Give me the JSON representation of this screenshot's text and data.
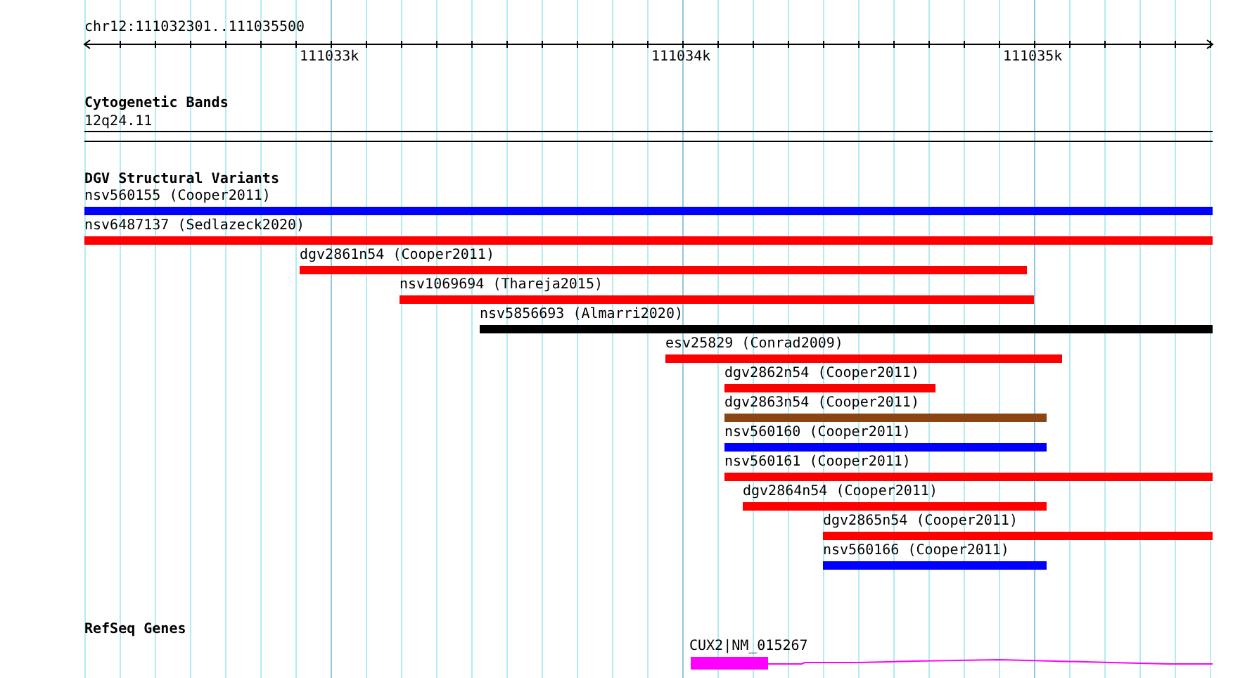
{
  "location": "chr12:111032301..111035500",
  "ruler": {
    "tick_labels": [
      "111033k",
      "111034k",
      "111035k"
    ]
  },
  "cytogenetic_bands": {
    "title": "Cytogenetic Bands",
    "band": "12q24.11"
  },
  "dgv": {
    "title": "DGV Structural Variants",
    "variants": [
      {
        "label": "nsv560155 (Cooper2011)",
        "color": "#0000ff"
      },
      {
        "label": "nsv6487137 (Sedlazeck2020)",
        "color": "#ff0000"
      },
      {
        "label": "dgv2861n54 (Cooper2011)",
        "color": "#ff0000"
      },
      {
        "label": "nsv1069694 (Thareja2015)",
        "color": "#ff0000"
      },
      {
        "label": "nsv5856693 (Almarri2020)",
        "color": "#000000"
      },
      {
        "label": "esv25829 (Conrad2009)",
        "color": "#ff0000"
      },
      {
        "label": "dgv2862n54 (Cooper2011)",
        "color": "#ff0000"
      },
      {
        "label": "dgv2863n54 (Cooper2011)",
        "color": "#8b4513"
      },
      {
        "label": "nsv560160 (Cooper2011)",
        "color": "#0000ff"
      },
      {
        "label": "nsv560161 (Cooper2011)",
        "color": "#ff0000"
      },
      {
        "label": "dgv2864n54 (Cooper2011)",
        "color": "#ff0000"
      },
      {
        "label": "dgv2865n54 (Cooper2011)",
        "color": "#ff0000"
      },
      {
        "label": "nsv560166 (Cooper2011)",
        "color": "#0000ff"
      }
    ]
  },
  "refseq": {
    "title": "RefSeq Genes",
    "genes": [
      {
        "label": "CUX2|NM_015267"
      }
    ]
  }
}
